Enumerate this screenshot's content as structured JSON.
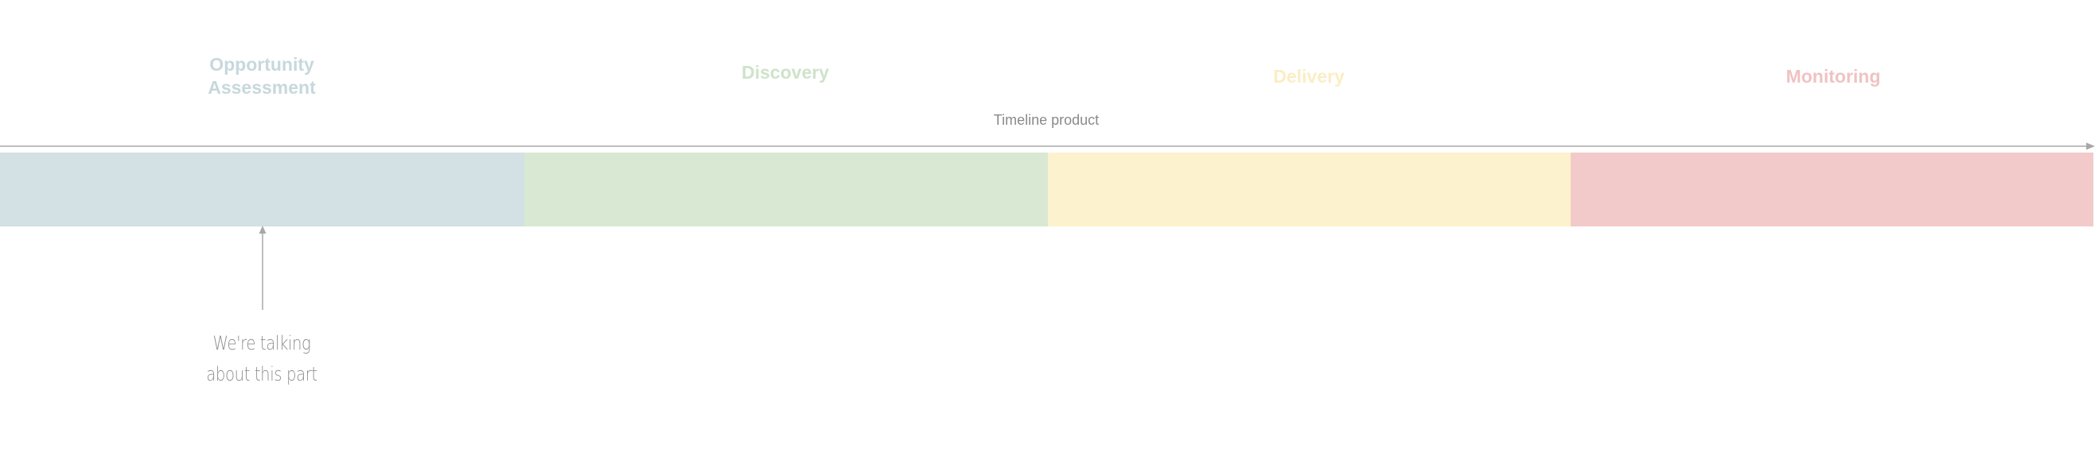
{
  "phases": [
    {
      "title": "Opportunity\nAssessment",
      "color": "#d3e0e4",
      "title_color": "#c7d8dd"
    },
    {
      "title": "Discovery",
      "color": "#d9e8d3",
      "title_color": "#cfe3c9"
    },
    {
      "title": "Delivery",
      "color": "#fdf2ce",
      "title_color": "#fbedc4"
    },
    {
      "title": "Monitoring",
      "color": "#f3caca",
      "title_color": "#efc3c3"
    }
  ],
  "timeline": {
    "label": "Timeline product",
    "line_color": "#a8a8a8"
  },
  "annotation": {
    "text": "We're talking\nabout this part",
    "arrow_color": "#a8a8a8"
  }
}
